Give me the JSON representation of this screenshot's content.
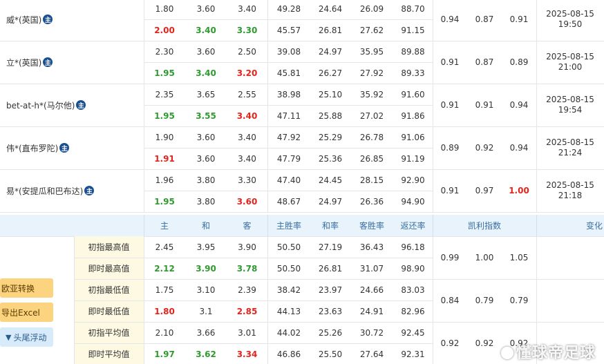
{
  "companies": [
    {
      "name": "威*(英国)",
      "initial": {
        "h": "1.80",
        "d": "3.60",
        "a": "3.40",
        "hr": "49.28",
        "dr": "24.64",
        "ar": "26.09",
        "ret": "88.70"
      },
      "live": {
        "h": "2.00",
        "d": "3.40",
        "a": "3.30",
        "hr": "45.57",
        "dr": "26.81",
        "ar": "27.62",
        "ret": "91.15"
      },
      "kelly": [
        "0.94",
        "0.87",
        "0.91"
      ],
      "date": "2025-08-15",
      "time": "19:50"
    },
    {
      "name": "立*(英国)",
      "initial": {
        "h": "2.30",
        "d": "3.60",
        "a": "2.50",
        "hr": "39.08",
        "dr": "24.97",
        "ar": "35.95",
        "ret": "89.88"
      },
      "live": {
        "h": "1.95",
        "d": "3.40",
        "a": "3.20",
        "hr": "45.81",
        "dr": "26.27",
        "ar": "27.92",
        "ret": "89.33"
      },
      "kelly": [
        "0.91",
        "0.87",
        "0.89"
      ],
      "date": "2025-08-15",
      "time": "21:00"
    },
    {
      "name": "bet-at-h*(马尔他)",
      "initial": {
        "h": "2.35",
        "d": "3.65",
        "a": "2.55",
        "hr": "38.98",
        "dr": "25.10",
        "ar": "35.92",
        "ret": "91.60"
      },
      "live": {
        "h": "1.95",
        "d": "3.55",
        "a": "3.40",
        "hr": "47.11",
        "dr": "25.88",
        "ar": "27.02",
        "ret": "91.86"
      },
      "kelly": [
        "0.91",
        "0.91",
        "0.94"
      ],
      "date": "2025-08-15",
      "time": "19:54"
    },
    {
      "name": "伟*(直布罗陀)",
      "initial": {
        "h": "1.90",
        "d": "3.60",
        "a": "3.40",
        "hr": "47.92",
        "dr": "25.29",
        "ar": "26.78",
        "ret": "91.06"
      },
      "live": {
        "h": "1.91",
        "d": "3.60",
        "a": "3.40",
        "hr": "47.79",
        "dr": "25.36",
        "ar": "26.85",
        "ret": "91.19"
      },
      "kelly": [
        "0.89",
        "0.92",
        "0.94"
      ],
      "date": "2025-08-15",
      "time": "21:24"
    },
    {
      "name": "易*(安提瓜和巴布达)",
      "initial": {
        "h": "1.96",
        "d": "3.80",
        "a": "3.30",
        "hr": "47.40",
        "dr": "24.45",
        "ar": "28.15",
        "ret": "92.90"
      },
      "live": {
        "h": "1.95",
        "d": "3.80",
        "a": "3.60",
        "hr": "48.67",
        "dr": "24.97",
        "ar": "26.36",
        "ret": "94.90"
      },
      "kelly": [
        "0.91",
        "0.97",
        "1.00"
      ],
      "date": "2025-08-15",
      "time": "21:18"
    }
  ],
  "zhu_icon": "主",
  "header": {
    "home": "主",
    "draw": "和",
    "away": "客",
    "home_rate": "主胜率",
    "draw_rate": "和率",
    "away_rate": "客胜率",
    "return_rate": "返还率",
    "kelly": "凯利指数",
    "change": "变化"
  },
  "stats": [
    {
      "label": "初指最高值",
      "h": "2.45",
      "d": "3.95",
      "a": "3.90",
      "hr": "50.50",
      "dr": "27.19",
      "ar": "36.43",
      "ret": "96.18"
    },
    {
      "label": "即时最高值",
      "h": "2.12",
      "d": "3.90",
      "a": "3.78",
      "hr": "50.50",
      "dr": "26.81",
      "ar": "31.07",
      "ret": "98.90"
    },
    {
      "label": "初指最低值",
      "h": "1.75",
      "d": "3.10",
      "a": "2.39",
      "hr": "38.42",
      "dr": "23.97",
      "ar": "24.66",
      "ret": "83.03"
    },
    {
      "label": "即时最低值",
      "h": "1.80",
      "d": "3.1",
      "a": "2.85",
      "hr": "44.13",
      "dr": "23.63",
      "ar": "24.91",
      "ret": "82.96"
    },
    {
      "label": "初指平均值",
      "h": "2.10",
      "d": "3.66",
      "a": "3.01",
      "hr": "44.02",
      "dr": "25.26",
      "ar": "30.72",
      "ret": "92.45"
    },
    {
      "label": "即时平均值",
      "h": "1.97",
      "d": "3.62",
      "a": "3.34",
      "hr": "46.86",
      "dr": "25.50",
      "ar": "27.64",
      "ret": "92.31"
    }
  ],
  "stat_kelly": [
    [
      "0.99",
      "1.00",
      "1.05"
    ],
    [
      "0.84",
      "0.79",
      "0.79"
    ],
    [
      "0.92",
      "0.92",
      "0.92"
    ]
  ],
  "buttons": {
    "convert": "欧亚转换",
    "export": "导出Excel",
    "float": "头尾浮动"
  },
  "watermark": "懂球帝足球",
  "colors": {
    "green": "#2e9b2e",
    "red": "#e4231b",
    "header_bg": "#e8f3fb",
    "stat_bg": "#fdf9e3",
    "button_bg": "#fcd37e"
  }
}
